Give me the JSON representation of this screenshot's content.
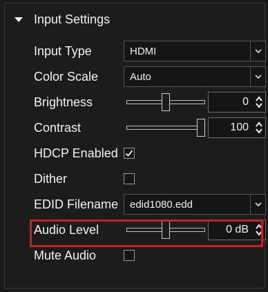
{
  "section": {
    "title": "Input Settings"
  },
  "fields": {
    "input_type": {
      "label": "Input Type",
      "value": "HDMI"
    },
    "color_scale": {
      "label": "Color Scale",
      "value": "Auto"
    },
    "brightness": {
      "label": "Brightness",
      "value": "0",
      "slider_fraction": 0.5
    },
    "contrast": {
      "label": "Contrast",
      "value": "100",
      "slider_fraction": 1.0
    },
    "hdcp_enabled": {
      "label": "HDCP Enabled",
      "checked": true
    },
    "dither": {
      "label": "Dither",
      "checked": false
    },
    "edid_filename": {
      "label": "EDID Filename",
      "value": "edid1080.edd"
    },
    "audio_level": {
      "label": "Audio Level",
      "value": "0 dB",
      "slider_fraction": 0.5
    },
    "mute_audio": {
      "label": "Mute Audio",
      "checked": false
    }
  },
  "colors": {
    "highlight": "#c8202a",
    "background": "#1c1c1c"
  },
  "icons": {
    "section_toggle": "triangle-down-icon",
    "dropdown": "chevron-down-icon",
    "spinner": "up-down-arrows-icon",
    "checkmark": "checkmark-icon"
  }
}
